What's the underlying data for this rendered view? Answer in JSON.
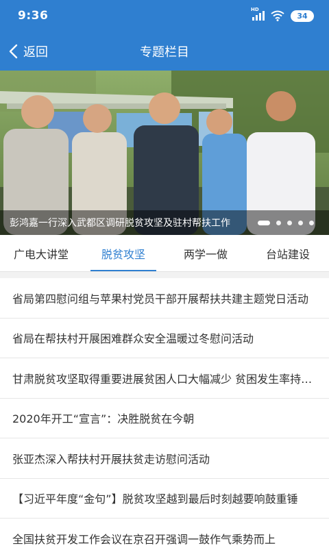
{
  "status": {
    "time": "9:36",
    "network": "HD",
    "battery": "34"
  },
  "header": {
    "back_label": "返回",
    "title": "专题栏目"
  },
  "banner": {
    "caption": "彭鸿嘉一行深入武都区调研脱贫攻坚及驻村帮扶工作",
    "slide_count": 5,
    "active_slide": 1
  },
  "tabs": [
    {
      "label": "广电大讲堂"
    },
    {
      "label": "脱贫攻坚"
    },
    {
      "label": "两学一做"
    },
    {
      "label": "台站建设"
    }
  ],
  "active_tab": 1,
  "news": [
    {
      "title": "省局第四慰问组与苹果村党员干部开展帮扶共建主题党日活动"
    },
    {
      "title": "省局在帮扶村开展困难群众安全温暖过冬慰问活动"
    },
    {
      "title": "甘肃脱贫攻坚取得重要进展贫困人口大幅减少 贫困发生率持续下降"
    },
    {
      "title": "2020年开工“宣言”：决胜脱贫在今朝"
    },
    {
      "title": "张亚杰深入帮扶村开展扶贫走访慰问活动"
    },
    {
      "title": "【习近平年度“金句”】脱贫攻坚越到最后时刻越要响鼓重锤"
    },
    {
      "title": "全国扶贫开发工作会议在京召开强调一鼓作气乘势而上"
    }
  ],
  "colors": {
    "primary": "#2f7fd0",
    "text": "#333333",
    "divider": "#e6e6e6"
  }
}
